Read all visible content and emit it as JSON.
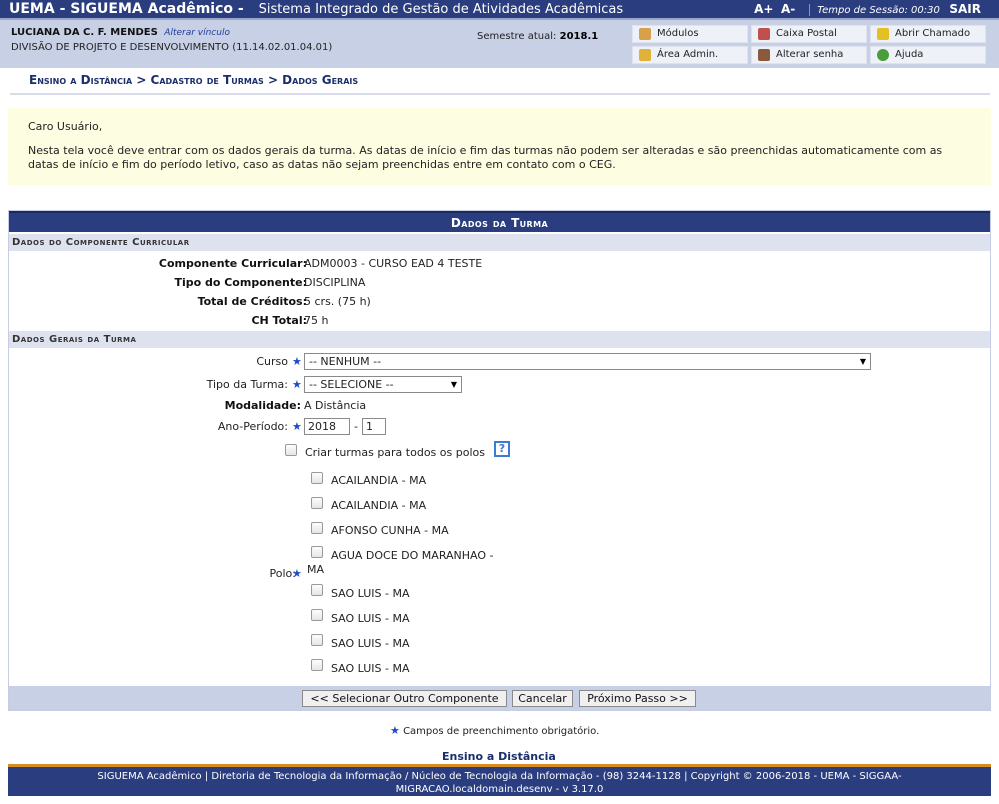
{
  "header": {
    "system_name": "UEMA - SIGUEMA Acadêmico -",
    "system_subtitle": "Sistema Integrado de Gestão de Atividades Acadêmicas",
    "font_increase": "A+",
    "font_decrease": "A-",
    "session_label": "Tempo de Sessão: 00:30",
    "logout_label": "SAIR"
  },
  "user": {
    "name": "LUCIANA DA C. F. MENDES",
    "change_link": "Alterar vínculo",
    "unit": "DIVISÃO DE PROJETO E DESENVOLVIMENTO (11.14.02.01.04.01)",
    "semester_label": "Semestre atual:",
    "semester_value": "2018.1"
  },
  "menu": {
    "modulos": "Módulos",
    "caixa_postal": "Caixa Postal",
    "abrir_chamado": "Abrir Chamado",
    "area_admin": "Área Admin.",
    "alterar_senha": "Alterar senha",
    "ajuda": "Ajuda"
  },
  "breadcrumb": "Ensino a Distância > Cadastro de Turmas > Dados Gerais",
  "notice": {
    "greeting": "Caro Usuário,",
    "text": "Nesta tela você deve entrar com os dados gerais da turma. As datas de início e fim das turmas não podem ser alteradas e são preenchidas automaticamente com as datas de início e fim do período letivo, caso as datas não sejam preenchidas entre em contato com o CEG."
  },
  "form": {
    "title": "Dados da Turma",
    "section_componente": "Dados do Componente Curricular",
    "componente_label": "Componente Curricular:",
    "componente_value": "ADM0003 - CURSO EAD 4 TESTE",
    "tipo_comp_label": "Tipo do Componente:",
    "tipo_comp_value": "DISCIPLINA",
    "creditos_label": "Total de Créditos:",
    "creditos_value": "5 crs. (75 h)",
    "ch_label": "CH Total:",
    "ch_value": "75 h",
    "section_gerais": "Dados Gerais da Turma",
    "curso_label": "Curso",
    "curso_value": "-- NENHUM --",
    "tipo_turma_label": "Tipo da Turma:",
    "tipo_turma_value": "-- SELECIONE --",
    "modalidade_label": "Modalidade:",
    "modalidade_value": "A Distância",
    "ano_periodo_label": "Ano-Período:",
    "ano_value": "2018",
    "periodo_separator": "-",
    "periodo_value": "1",
    "criar_todos_label": "Criar turmas para todos os polos",
    "help_icon": "?",
    "polo_label": "Polo:",
    "polos": [
      "ACAILANDIA - MA",
      "ACAILANDIA - MA",
      "AFONSO CUNHA - MA",
      "AGUA DOCE DO MARANHAO -",
      "SAO LUIS - MA",
      "SAO LUIS - MA",
      "SAO LUIS - MA",
      "SAO LUIS - MA"
    ],
    "polo_wrap_tail": "MA"
  },
  "buttons": {
    "selecionar": "<< Selecionar Outro Componente",
    "cancelar": "Cancelar",
    "proximo": "Próximo Passo >>"
  },
  "required_note": "Campos de preenchimento obrigatório.",
  "footer_link": "Ensino a Distância",
  "footer": {
    "line1": "SIGUEMA Acadêmico | Diretoria de Tecnologia da Informação / Núcleo de Tecnologia da Informação - (98) 3244-1128 | Copyright © 2006-2018 - UEMA - SIGGAA-",
    "line2": "MIGRACAO.localdomain.desenv - v 3.17.0"
  },
  "colors": {
    "primary": "#2a3d7e",
    "info_band": "#c8d0e6",
    "notice_bg": "#fdfde2",
    "accent": "#d58d24"
  }
}
